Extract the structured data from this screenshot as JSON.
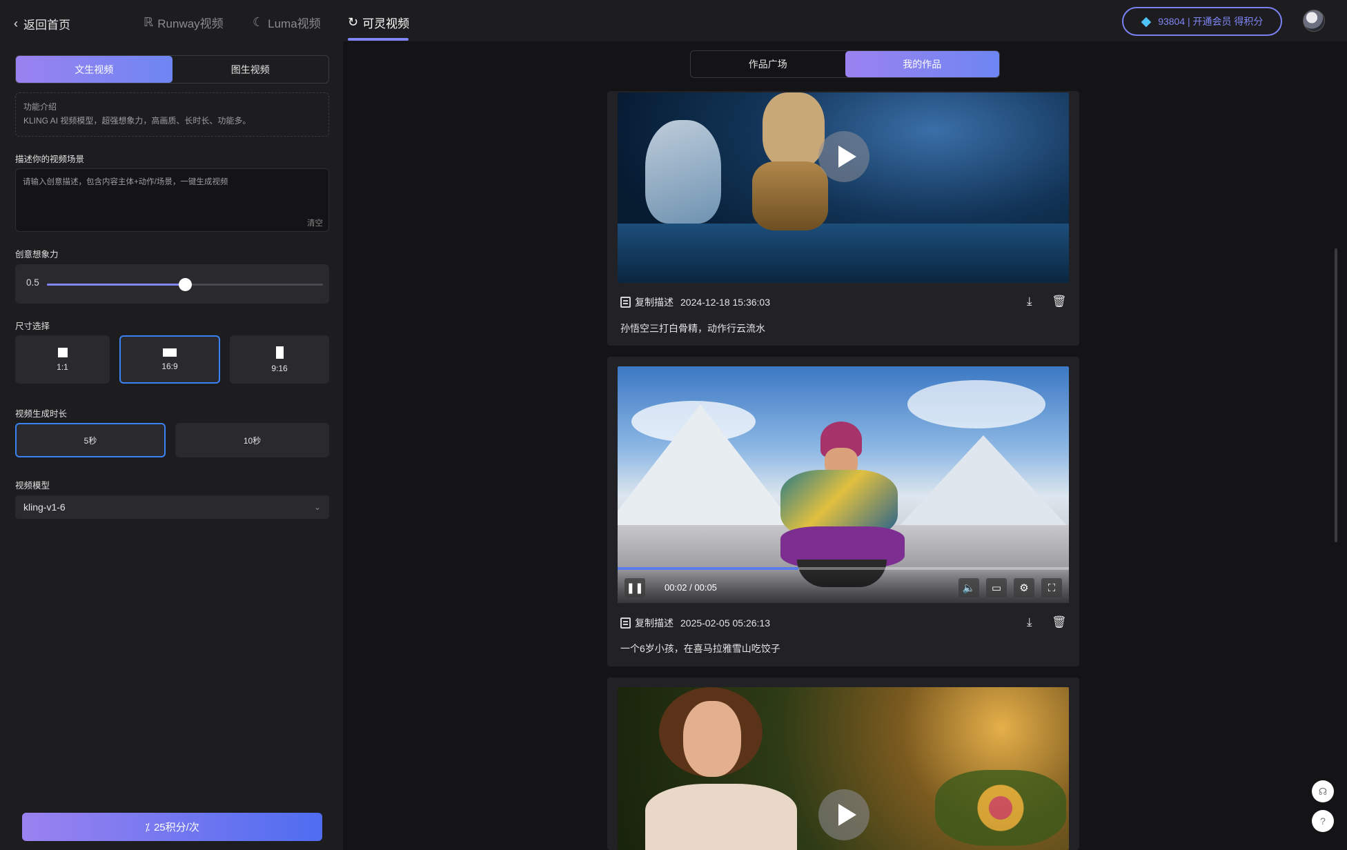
{
  "header": {
    "back_label": "返回首页",
    "tabs": [
      {
        "label": "Runway视频",
        "icon": "runway-icon"
      },
      {
        "label": "Luma视频",
        "icon": "luma-icon"
      },
      {
        "label": "可灵视频",
        "icon": "kling-icon",
        "active": true
      }
    ],
    "points_text": "93804 | 开通会员 得积分",
    "colors": {
      "accent": "#7f86f5",
      "selected_border": "#3b82f6"
    }
  },
  "sidebar": {
    "mode_tabs": [
      {
        "label": "文生视频",
        "active": true
      },
      {
        "label": "图生视频",
        "active": false
      }
    ],
    "intro_title": "功能介绍",
    "intro_text": "KLING AI 视频模型，超强想象力，高画质、长时长、功能多。",
    "prompt_label": "描述你的视频场景",
    "prompt_placeholder": "请输入创意描述，包含内容主体+动作/场景，一键生成视频",
    "clear_label": "清空",
    "creativity_label": "创意想象力",
    "creativity_value": "0.5",
    "creativity_fraction": 0.5,
    "size_label": "尺寸选择",
    "sizes": [
      {
        "label": "1:1",
        "selected": false
      },
      {
        "label": "16:9",
        "selected": true
      },
      {
        "label": "9:16",
        "selected": false
      }
    ],
    "duration_label": "视频生成时长",
    "durations": [
      {
        "label": "5秒",
        "selected": true
      },
      {
        "label": "10秒",
        "selected": false
      }
    ],
    "model_label": "视频模型",
    "model_value": "kling-v1-6",
    "generate_label": "25积分/次"
  },
  "main": {
    "tabs": [
      {
        "label": "作品广场",
        "active": false
      },
      {
        "label": "我的作品",
        "active": true
      }
    ],
    "works": [
      {
        "copy_label": "复制描述",
        "date": "2024-12-18 15:36:03",
        "description": "孙悟空三打白骨精，动作行云流水"
      },
      {
        "copy_label": "复制描述",
        "date": "2025-02-05 05:26:13",
        "description": "一个6岁小孩，在喜马拉雅雪山吃饺子",
        "player": {
          "time": "00:02 / 00:05",
          "progress_fraction": 0.4
        }
      },
      {
        "copy_label": "复制描述"
      }
    ]
  }
}
